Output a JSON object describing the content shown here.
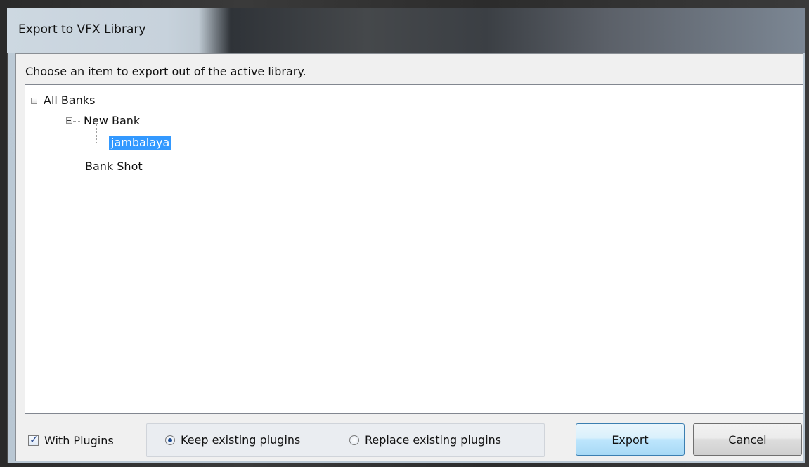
{
  "window": {
    "title": "Export to VFX Library"
  },
  "instruction": "Choose an item to export out of the active library.",
  "tree": {
    "root": {
      "label": "All Banks",
      "expanded": true,
      "children": [
        {
          "label": "New Bank",
          "expanded": true,
          "children": [
            {
              "label": "jambalaya",
              "selected": true
            }
          ]
        },
        {
          "label": "Bank Shot"
        }
      ]
    }
  },
  "options": {
    "with_plugins_label": "With Plugins",
    "with_plugins_checked": true,
    "keep_label": "Keep existing plugins",
    "replace_label": "Replace existing plugins",
    "selected_mode": "keep"
  },
  "buttons": {
    "export_label": "Export",
    "cancel_label": "Cancel"
  },
  "colors": {
    "selection": "#3399ff",
    "default_button": "#bee6fd"
  }
}
